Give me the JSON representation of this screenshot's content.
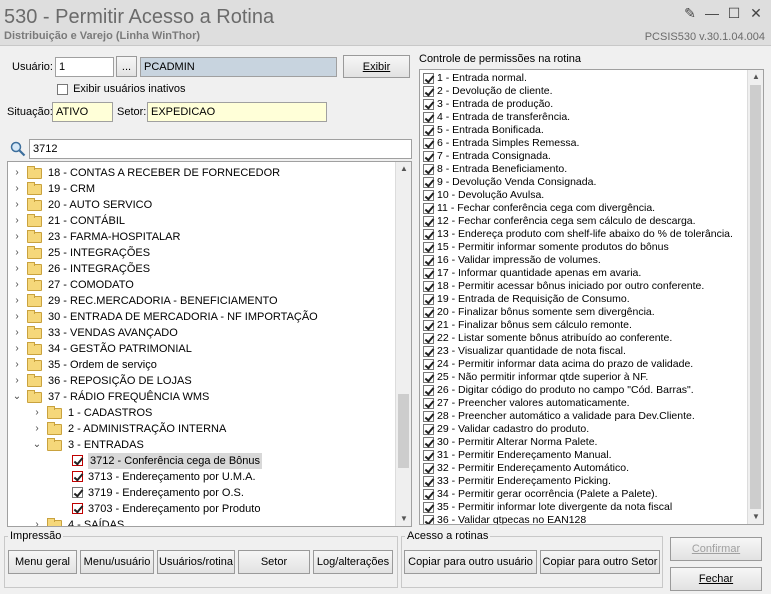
{
  "window": {
    "title": "530 - Permitir Acesso a Rotina",
    "subtitle": "Distribuição e Varejo (Linha WinThor)",
    "version": "PCSIS530  v.30.1.04.004",
    "controls": [
      "✎",
      "—",
      "☐",
      "✕"
    ]
  },
  "user": {
    "label": "Usuário:",
    "code": "1",
    "lookup_btn": "...",
    "name": "PCADMIN",
    "show_btn": "Exibir",
    "inactive_label": "Exibir usuários inativos",
    "inactive_checked": false,
    "situacao_label": "Situação:",
    "situacao": "ATIVO",
    "setor_label": "Setor:",
    "setor": "EXPEDICAO"
  },
  "search": {
    "icon": "search-icon",
    "value": "3712"
  },
  "tree": [
    {
      "label": "18 - CONTAS A RECEBER DE FORNECEDOR",
      "level": 0,
      "expanded": false,
      "type": "folder"
    },
    {
      "label": "19 - CRM",
      "level": 0,
      "expanded": false,
      "type": "folder"
    },
    {
      "label": "20 - AUTO SERVICO",
      "level": 0,
      "expanded": false,
      "type": "folder"
    },
    {
      "label": "21 - CONTÁBIL",
      "level": 0,
      "expanded": false,
      "type": "folder"
    },
    {
      "label": "23 - FARMA-HOSPITALAR",
      "level": 0,
      "expanded": false,
      "type": "folder"
    },
    {
      "label": "25 - INTEGRAÇÕES",
      "level": 0,
      "expanded": false,
      "type": "folder"
    },
    {
      "label": "26 - INTEGRAÇÕES",
      "level": 0,
      "expanded": false,
      "type": "folder"
    },
    {
      "label": "27 - COMODATO",
      "level": 0,
      "expanded": false,
      "type": "folder"
    },
    {
      "label": "29 - REC.MERCADORIA - BENEFICIAMENTO",
      "level": 0,
      "expanded": false,
      "type": "folder"
    },
    {
      "label": "30 - ENTRADA DE MERCADORIA - NF IMPORTAÇÃO",
      "level": 0,
      "expanded": false,
      "type": "folder"
    },
    {
      "label": "33 - VENDAS AVANÇADO",
      "level": 0,
      "expanded": false,
      "type": "folder"
    },
    {
      "label": "34 - GESTÃO PATRIMONIAL",
      "level": 0,
      "expanded": false,
      "type": "folder"
    },
    {
      "label": "35 - Ordem de serviço",
      "level": 0,
      "expanded": false,
      "type": "folder"
    },
    {
      "label": "36 - REPOSIÇÃO DE LOJAS",
      "level": 0,
      "expanded": false,
      "type": "folder"
    },
    {
      "label": "37 - RÁDIO FREQUÊNCIA WMS",
      "level": 0,
      "expanded": true,
      "type": "folder"
    },
    {
      "label": "1 - CADASTROS",
      "level": 1,
      "expanded": false,
      "type": "folder"
    },
    {
      "label": "2 - ADMINISTRAÇÃO INTERNA",
      "level": 1,
      "expanded": false,
      "type": "folder"
    },
    {
      "label": "3 - ENTRADAS",
      "level": 1,
      "expanded": true,
      "type": "folder"
    },
    {
      "label": "3712 - Conferência cega de Bônus",
      "level": 2,
      "type": "routine",
      "checked": true,
      "selected": true,
      "red": true
    },
    {
      "label": "3713 - Endereçamento por U.M.A.",
      "level": 2,
      "type": "routine",
      "checked": true,
      "red": true
    },
    {
      "label": "3719 - Endereçamento por O.S.",
      "level": 2,
      "type": "routine",
      "checked": true,
      "red": false
    },
    {
      "label": "3703 - Endereçamento por Produto",
      "level": 2,
      "type": "routine",
      "checked": true,
      "red": true
    },
    {
      "label": "4 - SAÍDAS",
      "level": 1,
      "expanded": false,
      "type": "folder"
    }
  ],
  "permissions": {
    "title": "Controle de permissões na rotina",
    "items": [
      "1 - Entrada normal.",
      "2 - Devolução de cliente.",
      "3 - Entrada de produção.",
      "4 - Entrada de transferência.",
      "5 - Entrada Bonificada.",
      "6 - Entrada Simples Remessa.",
      "7 - Entrada Consignada.",
      "8 - Entrada Beneficiamento.",
      "9 - Devolução Venda Consignada.",
      "10 - Devolução Avulsa.",
      "11 - Fechar conferência cega com divergência.",
      "12 - Fechar conferência cega sem cálculo de descarga.",
      "13 - Endereça produto com shelf-life abaixo do % de tolerância.",
      "15 - Permitir informar somente produtos do bônus",
      "16 - Validar impressão de volumes.",
      "17 - Informar quantidade apenas em avaria.",
      "18 - Permitir acessar bônus iniciado por outro conferente.",
      "19 - Entrada de Requisição de Consumo.",
      "20 - Finalizar bônus somente sem divergência.",
      "21 - Finalizar bônus sem cálculo remonte.",
      "22 - Listar somente bônus atribuído ao conferente.",
      "23 - Visualizar quantidade de nota fiscal.",
      "24 - Permitir informar data acima do prazo de validade.",
      "25 - Não permitir informar qtde superior à NF.",
      "26 - Digitar código do produto no campo \"Cód. Barras\".",
      "27 - Preencher valores automaticamente.",
      "28 - Preencher automático a validade para Dev.Cliente.",
      "29 - Validar cadastro do produto.",
      "30 - Permitir Alterar Norma Palete.",
      "31 - Permitir Endereçamento Manual.",
      "32 - Permitir Endereçamento Automático.",
      "33 - Permitir Endereçamento Picking.",
      "34 - Permitir gerar ocorrência (Palete a Palete).",
      "35 - Permitir informar lote divergente da nota fiscal",
      "36 - Validar qtpecas no EAN128"
    ]
  },
  "impressao": {
    "title": "Impressão",
    "buttons": [
      "Menu geral",
      "Menu/usuário",
      "Usuários/rotina",
      "Setor",
      "Log/alterações"
    ]
  },
  "acesso": {
    "title": "Acesso a rotinas",
    "buttons": [
      "Copiar para outro usuário",
      "Copiar para outro Setor"
    ]
  },
  "actions": {
    "confirm": "Confirmar",
    "close": "Fechar"
  }
}
